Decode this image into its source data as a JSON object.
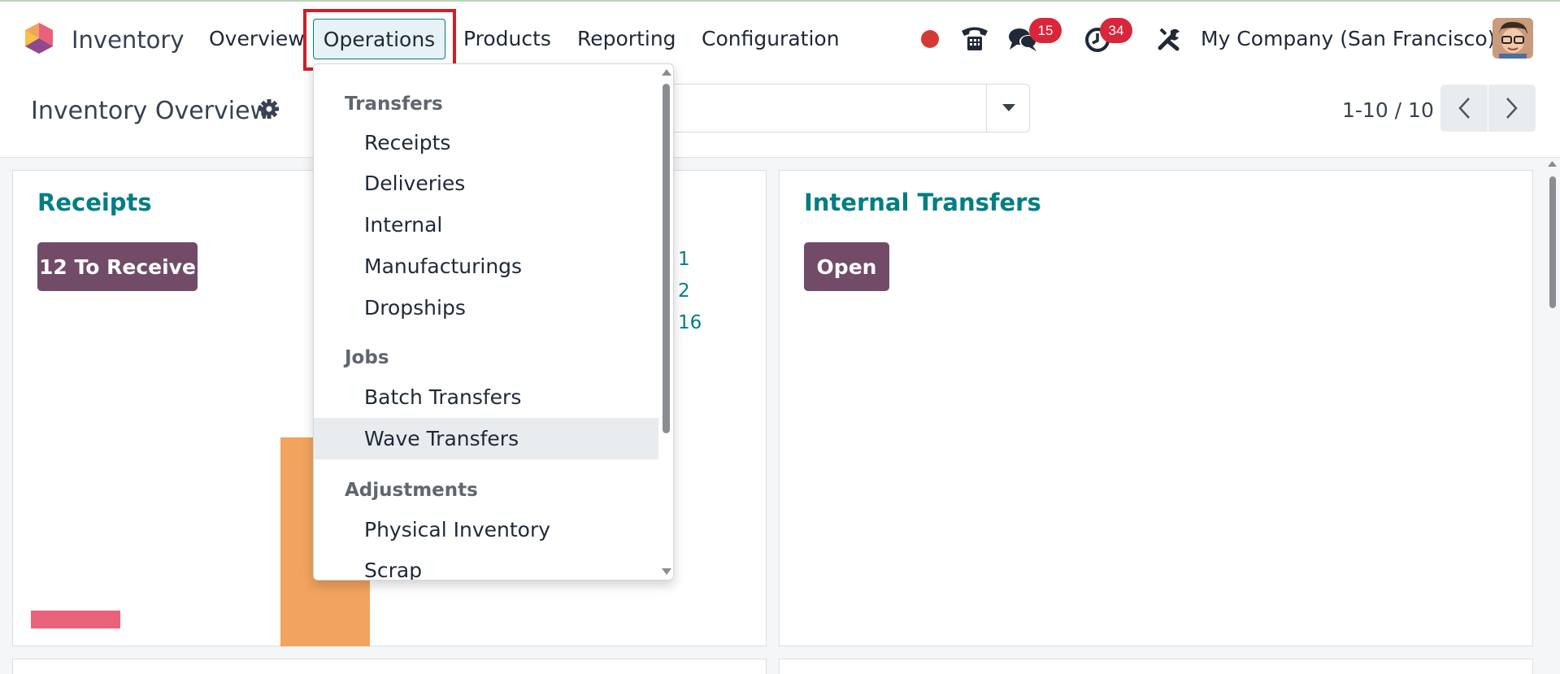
{
  "nav": {
    "app_name": "Inventory",
    "menu": [
      "Overview",
      "Operations",
      "Products",
      "Reporting",
      "Configuration"
    ],
    "active_menu": "Operations",
    "messages_count": "15",
    "activities_count": "34",
    "company": "My Company (San Francisco)"
  },
  "control_panel": {
    "title": "Inventory Overview",
    "pager": "1-10 / 10"
  },
  "dropdown": {
    "sections": [
      {
        "header": "Transfers",
        "items": [
          "Receipts",
          "Deliveries",
          "Internal",
          "Manufacturings",
          "Dropships"
        ]
      },
      {
        "header": "Jobs",
        "items": [
          "Batch Transfers",
          "Wave Transfers"
        ]
      },
      {
        "header": "Adjustments",
        "items": [
          "Physical Inventory",
          "Scrap"
        ]
      }
    ],
    "hovered_item": "Wave Transfers"
  },
  "cards": {
    "receipts": {
      "title": "Receipts",
      "button": "12 To Receive"
    },
    "hidden_card": {
      "stats": [
        "1",
        "2",
        "16"
      ]
    },
    "internal": {
      "title": "Internal Transfers",
      "button": "Open"
    }
  },
  "colors": {
    "brand": "#714b67",
    "accent": "#017e84",
    "badge": "#d9263a",
    "bar_pink": "#e8637a",
    "bar_orange": "#f2a35e",
    "highlight_box": "#cc1f2a"
  }
}
